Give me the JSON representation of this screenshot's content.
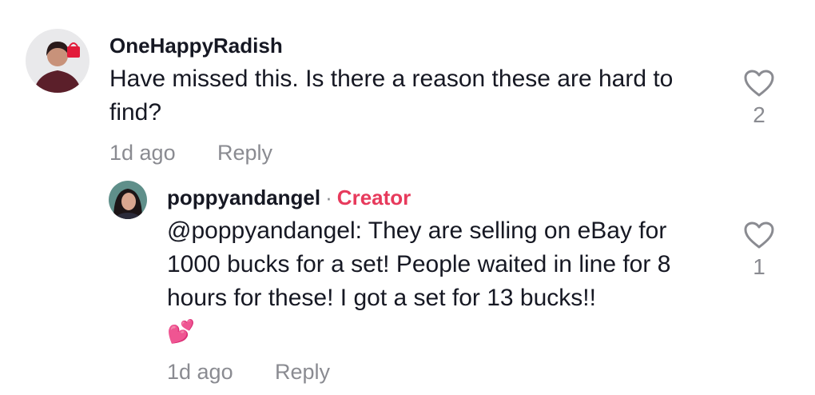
{
  "comments": [
    {
      "username": "OneHappyRadish",
      "text": "Have missed this. Is there a reason these are hard to find?",
      "time": "1d ago",
      "reply_label": "Reply",
      "likes": "2",
      "avatar_icon": "avatar-woman-red-bag"
    }
  ],
  "replies": [
    {
      "username": "poppyandangel",
      "separator": "·",
      "badge": "Creator",
      "text": "@poppyandangel: They are selling on eBay for 1000 bucks for a set! People waited in line for 8 hours for these! I got a set for 13 bucks!!",
      "emoji": "💕",
      "time": "1d ago",
      "reply_label": "Reply",
      "likes": "1",
      "avatar_icon": "avatar-woman-dark-hair"
    }
  ],
  "colors": {
    "creator_accent": "#e73a5c",
    "meta_gray": "#8a8b91",
    "text": "#161823"
  }
}
